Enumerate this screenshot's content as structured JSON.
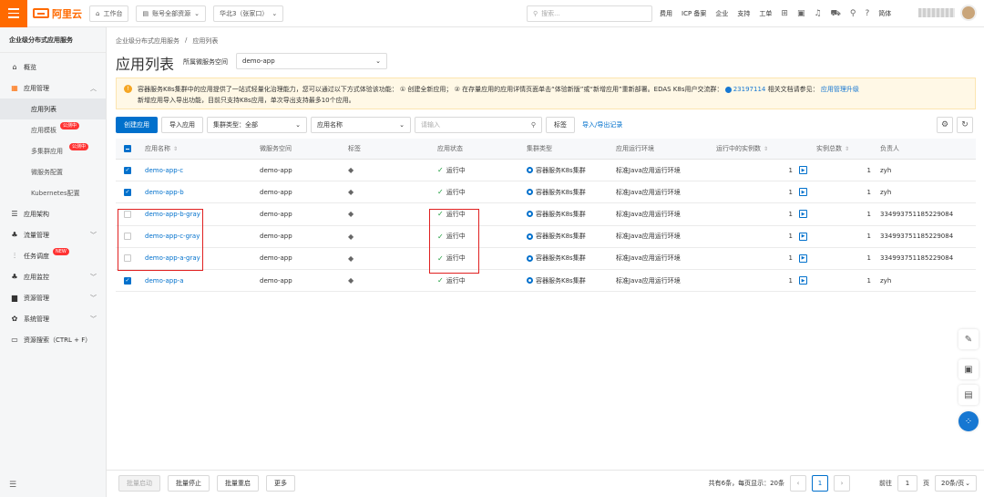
{
  "topbar": {
    "logo_text": "阿里云",
    "workbench": "工作台",
    "account_scope": "账号全部资源",
    "region": "华北3（张家口）",
    "search_placeholder": "搜索...",
    "links": [
      "费用",
      "ICP 备案",
      "企业",
      "支持",
      "工单"
    ],
    "language": "简体"
  },
  "sidebar": {
    "title": "企业级分布式应用服务",
    "items": [
      {
        "label": "概览",
        "icon": "home-icon"
      },
      {
        "label": "应用管理",
        "icon": "grid-icon",
        "expanded": true,
        "children": [
          {
            "label": "应用列表",
            "active": true
          },
          {
            "label": "应用模板",
            "badge": "公测中"
          },
          {
            "label": "多集群应用",
            "badge": "公测中"
          },
          {
            "label": "微服务配置"
          },
          {
            "label": "Kubernetes配置"
          }
        ]
      },
      {
        "label": "应用架构",
        "icon": "layers-icon"
      },
      {
        "label": "流量管理",
        "icon": "flow-icon"
      },
      {
        "label": "任务调度",
        "icon": "schedule-icon",
        "badge": "NEW"
      },
      {
        "label": "应用监控",
        "icon": "monitor-icon"
      },
      {
        "label": "资源管理",
        "icon": "resource-icon"
      },
      {
        "label": "系统管理",
        "icon": "gear-icon"
      },
      {
        "label": "资源搜索（CTRL + F）",
        "icon": "search-resource-icon"
      }
    ],
    "footer_icon": "menu-icon"
  },
  "main": {
    "breadcrumb": [
      "企业级分布式应用服务",
      "应用列表"
    ],
    "title": "应用列表",
    "namespace_label": "所属微服务空间",
    "namespace_value": "demo-app",
    "notice": {
      "line1": "容器服务K8s集群中的应用提供了一站式轻量化治理能力，您可以通过以下方式体验该功能： ① 创建全新应用； ② 在存量应用的应用详情页面单击“体验新版”或“新增应用”重新部署。EDAS K8s用户交流群：",
      "group_number": "23197114",
      "docs_prefix": " 相关文档请参见：",
      "docs_link": "应用管理升级",
      "line2": "新增应用导入导出功能，目前只支持K8s应用，单次导出支持最多10个应用。"
    },
    "toolbar": {
      "create": "创建应用",
      "import": "导入应用",
      "cluster_type_label": "集群类型：全部",
      "filter_field": "应用名称",
      "search_placeholder": "请输入",
      "tags": "标签",
      "import_export_log": "导入/导出记录"
    },
    "table": {
      "headers": [
        "应用名称",
        "微服务空间",
        "标签",
        "应用状态",
        "集群类型",
        "应用运行环境",
        "运行中的实例数",
        "实例总数",
        "负责人"
      ],
      "rows": [
        {
          "checked": true,
          "name": "demo-app-c",
          "ns": "demo-app",
          "status": "运行中",
          "cluster": "容器服务K8s集群",
          "env": "标准Java应用运行环境",
          "running": "1",
          "total": "1",
          "owner": "zyh"
        },
        {
          "checked": true,
          "name": "demo-app-b",
          "ns": "demo-app",
          "status": "运行中",
          "cluster": "容器服务K8s集群",
          "env": "标准Java应用运行环境",
          "running": "1",
          "total": "1",
          "owner": "zyh"
        },
        {
          "checked": false,
          "name": "demo-app-b-gray",
          "ns": "demo-app",
          "status": "运行中",
          "cluster": "容器服务K8s集群",
          "env": "标准Java应用运行环境",
          "running": "1",
          "total": "1",
          "owner": "334993751185229084"
        },
        {
          "checked": false,
          "name": "demo-app-c-gray",
          "ns": "demo-app",
          "status": "运行中",
          "cluster": "容器服务K8s集群",
          "env": "标准Java应用运行环境",
          "running": "1",
          "total": "1",
          "owner": "334993751185229084"
        },
        {
          "checked": false,
          "name": "demo-app-a-gray",
          "ns": "demo-app",
          "status": "运行中",
          "cluster": "容器服务K8s集群",
          "env": "标准Java应用运行环境",
          "running": "1",
          "total": "1",
          "owner": "334993751185229084"
        },
        {
          "checked": true,
          "name": "demo-app-a",
          "ns": "demo-app",
          "status": "运行中",
          "cluster": "容器服务K8s集群",
          "env": "标准Java应用运行环境",
          "running": "1",
          "total": "1",
          "owner": "zyh"
        }
      ]
    },
    "footer": {
      "batch_start": "批量启动",
      "batch_stop": "批量停止",
      "batch_restart": "批量重启",
      "more": "更多",
      "total_text": "共有6条，每页显示：20条",
      "current_page": "1",
      "goto_label": "前往",
      "goto_value": "1",
      "page_unit": "页",
      "page_size": "20条/页"
    }
  },
  "colors": {
    "brand_orange": "#ff6a00",
    "primary_blue": "#0070cc",
    "running_green": "#1e9e3e",
    "highlight_red": "#e02020"
  }
}
